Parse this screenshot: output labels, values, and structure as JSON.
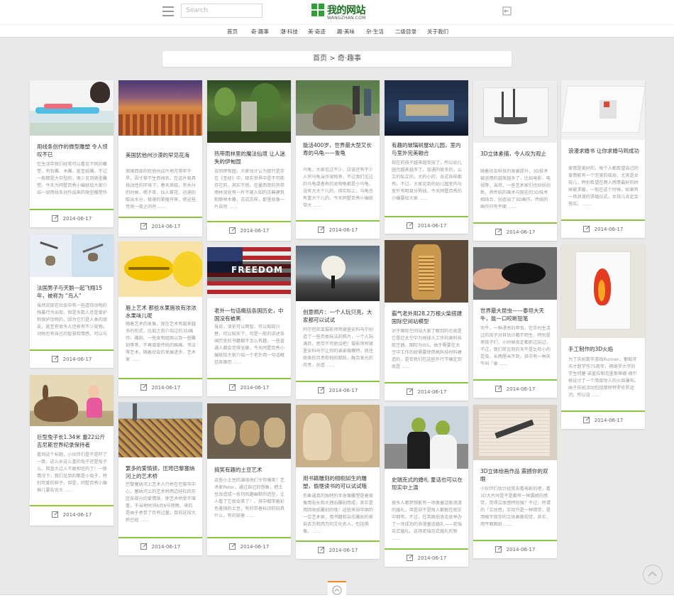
{
  "header": {
    "search_placeholder": "Search",
    "logo_text": "我的网站",
    "logo_sub": "WANGZHAN.COM"
  },
  "nav": [
    "首页",
    "奇·趣事",
    "潮·科技",
    "美·奇迹",
    "趣·美味",
    "杂·生活",
    "二级目录",
    "关于我们"
  ],
  "breadcrumb": {
    "home": "首页",
    "sep": " > ",
    "current": "奇·趣事"
  },
  "colors": {
    "accent_green": "#8cc63f",
    "logo_green": "#2f9e33",
    "scroll_orange": "#f08a24"
  },
  "cards": [
    {
      "title": "用线条创作的微型雕塑 令人惊叹不已",
      "excerpt": "在生活中我们经常可以看见不同的雕塑，有石雕、木雕、甚至纸雕，不过一般都是大中型的，很少见到微型雕塑。今天为同墅百秀小编就给大家介绍一组用线条创作出来的微型雕塑作品，小 ......",
      "date": "2014-06-17"
    },
    {
      "title": "美国犹他州沙漠的罕见花海",
      "excerpt": "美国西部的犹他州这片地方常年干旱，因寸草不生而闻名。在这片极具挑战性的环境下，春天来临，有水分的时候，嗯子草、仙人掌花，迅速的取出水分，极速的繁殖开来，使这些荒地一夜之间开 ......",
      "date": "2014-06-17"
    },
    {
      "title": "热带雨林里的魔法仙境 让人迷失的伊甸园",
      "excerpt": "说到伊甸园，大家估计认为那只是存在《圣经》中，现实世界中是不可能存在的，其实不然。在墨西哥的热带雨林深处有一片不被人知的古典建筑和原林木雕，古式古样，那里就像一片自然 ......",
      "date": "2014-06-17"
    },
    {
      "title": "能活400岁，世界最大型又长寿的乌龟——象龟",
      "excerpt": "乌龟，大家见过不少，应该还有不少人将乌龟当作宠物养，不过我们见过的乌龟或者养的宠物龟都是小乌龟，没有大大个儿的，但实际上，乌龟也有重大个儿的，今天同墅百秀小编就带大 ......",
      "date": "2014-06-17"
    },
    {
      "title": "有趣的玻璃树屋幼儿园，室内与室外完美融合",
      "excerpt": "现在的孩子越来越受宠了，所以幼儿园也越来越多了，普通的很多的，公立的私立的，大的小的，各式各样都有，不过，大家见到的幼儿园室内与室外有明显分界线，今天同墅百秀的小编要给大家 ......",
      "date": "2014-06-17"
    },
    {
      "title": "3D立体素描，令人叹为观止",
      "excerpt": "随着社会科技的发展提升，3D技术被运用的越来越多了，比如电影、电视等，当然，一些艺术家们也纷纷创新，将传统的画术与现在的3D技术相结合，创造出了3D画作。传统的画作只有平面 ......",
      "date": "2014-06-17"
    },
    {
      "title": "浪漫求婚书 让你求婚马到成功",
      "excerpt": "爱情是美好的，每个人都希望自己的爱情能有一个完美的结局，尤其是女孩儿，特别希望在两人感情最好的时候被求婚，一般在这个时候，如果有一场浪漫的求婚仪式，女孩儿肯定会答应。 ......",
      "date": "2014-06-17"
    },
    {
      "title": "法国男子与天鹅一起飞翔15年，被称为 “鸟人”",
      "excerpt": "虽然说现在社会中有一些虐待动物的残暴行为出现，但是多数人还是爱护和保护动物的，因为它们是人类的朋友，甚至有很多人还养有不少宠物。动物也有自己的智慧和情感，可以与人 ......",
      "date": "2014-06-17"
    },
    {
      "title": "唇上艺术 那些水果唇妆有浓浓水果味儿呢",
      "excerpt": "随着艺术的发展，现在艺术有越来越多的形式，比如之前介绍过的3D画作、雕刻、一些食物组图以及一些雕刻等等，不再单单传统的画画、书法等艺术。随着社会的发展进步，艺术家 ......",
      "date": "2014-06-17"
    },
    {
      "title": "老外一句话概括各国历史，中国没有被黑",
      "excerpt": "虽说，读史可以明智，可以知晓兴替，可以知天下，可是一般的讲述各国历史的书籍都不怎么有趣，一些普通人都会觉得无聊。今天同墅百秀小编就给大家介绍一个老外用一句话概括各国历 ......",
      "date": "2014-06-17"
    },
    {
      "title": "创意照片：一个人玩只亮，大家都可以试试",
      "excerpt": "阿尔巴尼亚摄影师阿德里安科马尔创造了一些另类玩法的照片，一个人玩满月，感觉不可思议吧！摄影师阿德里安科马尔让你的弟弟做模特，抓住绝美的月亮和他的跳跃，融合发光的月亮，创造 ......",
      "date": "2014-06-17"
    },
    {
      "title": "霸气老外用28.2万根火柴搭建国际空间站模型",
      "excerpt": "对于国际空间站大家了解到的也就是它是在太空中为地球人工作的高科技航空器，国际为ISS，由于需要在太空中工作的就需要使用高科技材料建造的，是否我们在这些外行不确定到底是 ......",
      "date": "2014-06-17"
    },
    {
      "title": "世界最大昆虫——泰坦大天牛，能一口咬断铅笔",
      "excerpt": "天牛，一种漂亮的甲虫，在农村生活过的孩子对其估计都不陌生，特别是男孩子们，小时候肯定都抓过玩过，不过，我们常见到的天牛是比较小的昆虫，长两厘米不到，其中有一种天牛叫「泰 ......",
      "date": "2014-06-17"
    },
    {
      "title": "手工制作的3D火焰",
      "excerpt": "为了庆祝数字游戏Runner，葡萄牙天才数学作75周年，网络罗大学的学生何塞·诺盖拉和克里斯蒂娜·德尔格设计了一个简单惊人的火焰瀑布。由于庆祝活动包括那阿特罗伦罗运河，所以设 ......",
      "date": "2014-06-17"
    },
    {
      "title": "巨型兔子长1.34米 重22公斤 吉尼斯世界纪录保持者",
      "excerpt": "看到这个标题，小伙伴们是不是吓了一跳，这么长这么重的兔子还是兔子么，简直大过人不敢相信的了！一般情况下，我们见到的都是小兔子，特别可爱的样子，但是，同墅百秀小编搞儿要告诉大 ......",
      "date": "2014-06-17"
    },
    {
      "title": "繁多的爱情锁，压垮巴黎塞纳河上的艺术桥",
      "excerpt": "巴黎塞纳河上艺术人行桥在巴黎市中心，塞纳河上的艺术桥两边扶栏的东区各部分的爱情锁，使艺术桥受不堪重，于当地时间6月8号傍晚，来的是由于承受了负有过量，目前这段大桥已经 ......",
      "date": "2014-06-17"
    },
    {
      "title": "搞笑有趣的土豆艺术",
      "excerpt": "这些小土豆的演绎他们令你爆笑！艺术家Peter，通过自己的想象，把土豆改造成一系列风趣幽默的造型，让人看了它就会笑了！，其中都带着彩色墨镜的土豆，有的带着标识的玩具什么，有的穿着 ......",
      "date": "2014-06-17"
    },
    {
      "title": "用书籍雕刻的栩栩如生的雕塑，偷惬读书的可以试试哦",
      "excerpt": "形象逼真的独特的半身像雕塑是着很像用石头和大理石雕刻而成，其实是用回收纸雕刻的哦！这些来自中国的一位艺术家，用书籍和杂志雕刻的来自古方和西方的文化名人，包括佛像、 ......",
      "date": "2014-06-17"
    },
    {
      "title": "史瑞克式的婚礼 童话也可以在现实中上演",
      "excerpt": "很多人都梦想能有一场像童话般浪漫的婚礼，但是却不是每人都能在现实中拥有。不过，在英国伯洛克就举办了一场成功的浪漫童话婚礼——史瑞克式婚礼。这场史瑞克式婚礼的新 ......",
      "date": "2014-06-17"
    },
    {
      "title": "3D立体绘画作品 震撼你的双眼",
      "excerpt": "小伙伴们估计经常去看电影的吧，看3D大片时是不是都有一种震撼的感觉，觉得立体感特别强？不过，所谓的「立体感」实际只是一种错觉，是用眼不现存的立体画面视觉，其实，用平面图纸 ......",
      "date": "2014-06-17"
    }
  ]
}
